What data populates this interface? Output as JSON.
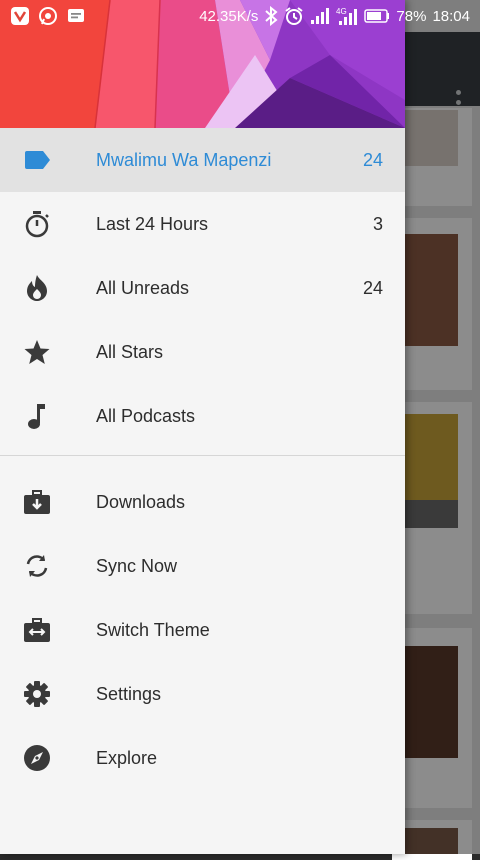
{
  "status_bar": {
    "network_speed": "42.35K/s",
    "battery_percent": "78%",
    "time": "18:04",
    "left_icons": [
      "vpn-icon",
      "whatsapp-icon",
      "message-icon"
    ],
    "right_icons": [
      "bluetooth-icon",
      "alarm-icon",
      "signal-icon",
      "signal-4g-icon",
      "battery-icon"
    ]
  },
  "drawer": {
    "feeds": [
      {
        "label": "Mwalimu Wa Mapenzi",
        "count": "24",
        "icon": "label-tag-icon",
        "active": true
      },
      {
        "label": "Last 24 Hours",
        "count": "3",
        "icon": "timer-icon"
      },
      {
        "label": "All Unreads",
        "count": "24",
        "icon": "flame-icon"
      },
      {
        "label": "All Stars",
        "count": "",
        "icon": "star-icon"
      },
      {
        "label": "All Podcasts",
        "count": "",
        "icon": "music-note-icon"
      }
    ],
    "actions": [
      {
        "label": "Downloads",
        "icon": "download-briefcase-icon"
      },
      {
        "label": "Sync Now",
        "icon": "sync-icon"
      },
      {
        "label": "Switch Theme",
        "icon": "switch-theme-icon"
      },
      {
        "label": "Settings",
        "icon": "gear-icon"
      },
      {
        "label": "Explore",
        "icon": "compass-icon"
      }
    ]
  },
  "colors": {
    "accent": "#2e8bd6",
    "drawer_background": "#f5f5f5",
    "active_row": "#e2e2e2",
    "icon": "#3a3a3a"
  }
}
